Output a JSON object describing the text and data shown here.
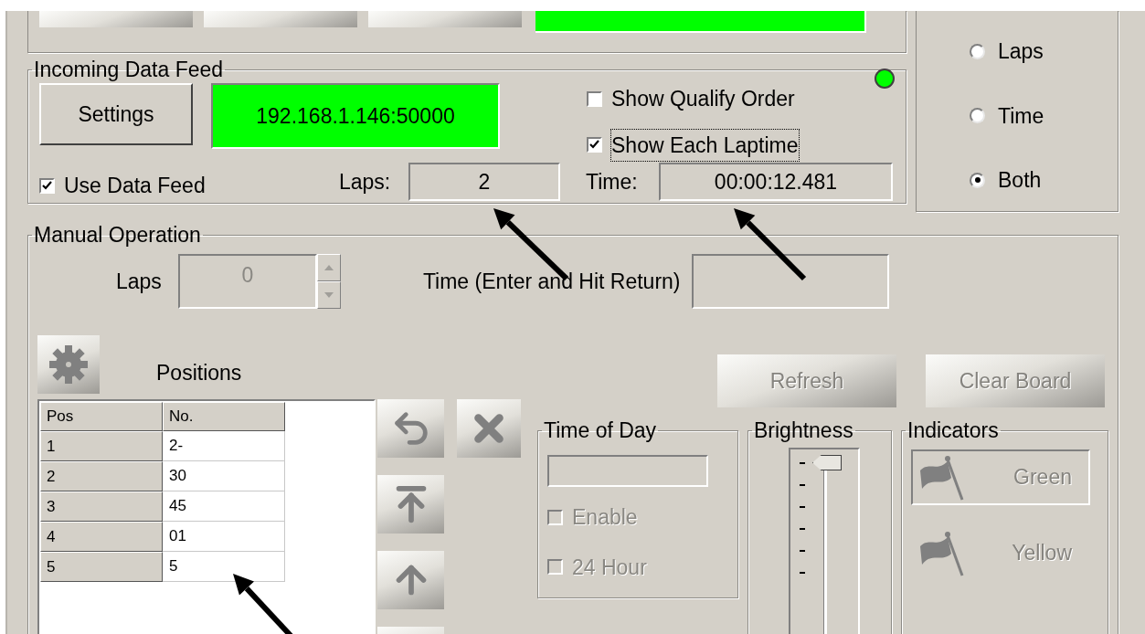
{
  "incoming_data_feed": {
    "title": "Incoming Data Feed",
    "settings_button": "Settings",
    "address": "192.168.1.146:50000",
    "connected": true,
    "options": [
      {
        "label": "Show Qualify Order",
        "checked": false,
        "focused": false
      },
      {
        "label": "Show Each Laptime",
        "checked": true,
        "focused": true
      }
    ],
    "use_data_feed": {
      "label": "Use Data Feed",
      "checked": true
    },
    "laps": {
      "label": "Laps:",
      "value": "2"
    },
    "time": {
      "label": "Time:",
      "value": "00:00:12.481"
    }
  },
  "display_mode": [
    {
      "label": "Laps",
      "selected": false
    },
    {
      "label": "Time",
      "selected": false
    },
    {
      "label": "Both",
      "selected": true
    }
  ],
  "manual_operation": {
    "title": "Manual Operation",
    "laps": {
      "label": "Laps",
      "value": "0",
      "disabled": true
    },
    "time": {
      "label": "Time (Enter and Hit Return)"
    },
    "positions": {
      "title": "Positions",
      "columns": [
        "Pos",
        "No."
      ],
      "rows": [
        [
          "1",
          "2-"
        ],
        [
          "2",
          "30"
        ],
        [
          "3",
          "45"
        ],
        [
          "4",
          "01"
        ],
        [
          "5",
          "5"
        ]
      ]
    },
    "refresh_button": {
      "label": "Refresh",
      "disabled": true
    },
    "clear_board_button": {
      "label": "Clear Board",
      "disabled": true
    },
    "time_of_day": {
      "title": "Time of Day",
      "options": [
        {
          "label": "Enable",
          "checked": false,
          "disabled": true
        },
        {
          "label": "24 Hour",
          "checked": false,
          "disabled": true
        }
      ]
    },
    "brightness": {
      "title": "Brightness",
      "level": 1
    },
    "indicators": {
      "title": "Indicators",
      "items": [
        {
          "label": "Green",
          "selected": true,
          "disabled": true
        },
        {
          "label": "Yellow",
          "selected": false,
          "disabled": true
        }
      ]
    }
  }
}
